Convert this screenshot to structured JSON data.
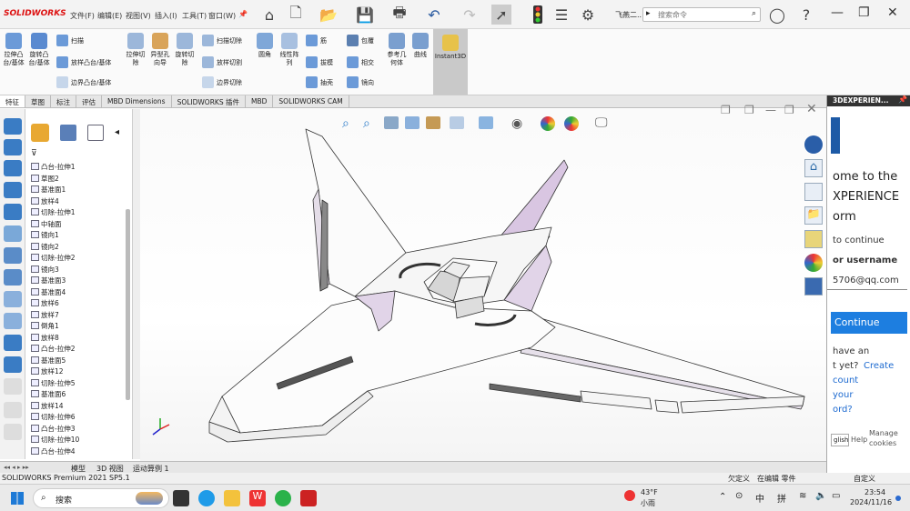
{
  "app": {
    "logo": "SOLIDWORKS",
    "search_placeholder": "搜索命令",
    "user": "飞燕二..."
  },
  "menus": [
    "文件(F)",
    "编辑(E)",
    "视图(V)",
    "插入(I)",
    "工具(T)",
    "窗口(W)"
  ],
  "ribbon": {
    "big": [
      "拉伸凸台/基体",
      "旋转凸台/基体"
    ],
    "small_a": [
      "扫描",
      "放样凸台/基体",
      "边界凸台/基体"
    ],
    "big2": [
      "拉伸切除",
      "异型孔向导",
      "旋转切除"
    ],
    "small_b": [
      "扫描切除",
      "放样切割",
      "边界切除"
    ],
    "big3": [
      "圆角",
      "线性阵列"
    ],
    "small_c": [
      "筋",
      "拔模",
      "抽壳"
    ],
    "small_d": [
      "包覆",
      "相交",
      "镜向"
    ],
    "big4": [
      "参考几何体",
      "曲线",
      "Instant3D"
    ]
  },
  "tabs": [
    "特征",
    "草图",
    "标注",
    "评估",
    "MBD Dimensions",
    "SOLIDWORKS 插件",
    "MBD",
    "SOLIDWORKS CAM"
  ],
  "tree": [
    "凸台-拉伸1",
    "草图2",
    "基准面1",
    "放样4",
    "切除-拉伸1",
    "中轴面",
    "镜向1",
    "镜向2",
    "切除-拉伸2",
    "镜向3",
    "基准面3",
    "基准面4",
    "放样6",
    "放样7",
    "倒角1",
    "放样8",
    "凸台-拉伸2",
    "基准面5",
    "放样12",
    "切除-拉伸5",
    "基准面6",
    "放样14",
    "切除-拉伸6",
    "凸台-拉伸3",
    "切除-拉伸10",
    "凸台-拉伸4"
  ],
  "bottom_tabs": [
    "模型",
    "3D 视图",
    "运动算例 1"
  ],
  "status": {
    "left": "SOLIDWORKS Premium 2021 SP5.1",
    "mid1": "欠定义",
    "mid2": "在编辑 零件",
    "right": "自定义"
  },
  "rpanel": {
    "title": "3DEXPERIEN...",
    "l1": "ome to the",
    "l2": "XPERIENCE",
    "l3": "orm",
    "l4": "to continue",
    "l5": "or username",
    "email": "5706@qq.com",
    "btn": "Continue",
    "l6": "have an",
    "l7": "t yet?",
    "create": "Create",
    "l8": "count",
    "l9": "your",
    "l10": "ord?",
    "eng": "glish",
    "help": "Help",
    "manage": "Manage cookies"
  },
  "taskbar": {
    "search": "搜索",
    "weather_temp": "43°F",
    "weather_desc": "小雨",
    "ime1": "中",
    "ime2": "拼",
    "time": "23:54",
    "date": "2024/11/16"
  }
}
